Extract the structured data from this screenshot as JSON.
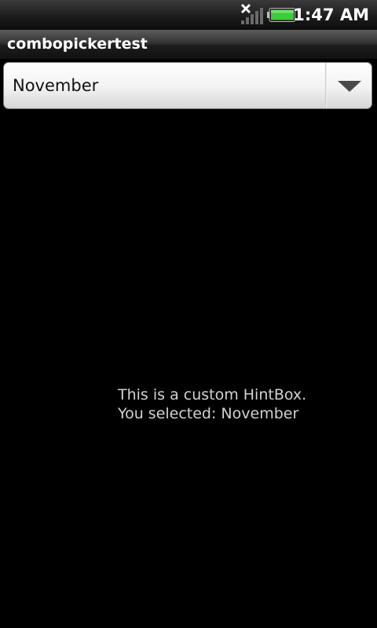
{
  "status_bar": {
    "time": "1:47 AM",
    "signal_icon": "no-signal-icon",
    "battery_icon": "battery-full-icon",
    "battery_color": "#33cc33"
  },
  "app": {
    "title": "combopickertest"
  },
  "spinner": {
    "selected_value": "November",
    "arrow_icon": "dropdown-arrow-icon"
  },
  "hint_box": {
    "line1": "This is a custom HintBox.",
    "line2": "You selected: November"
  }
}
